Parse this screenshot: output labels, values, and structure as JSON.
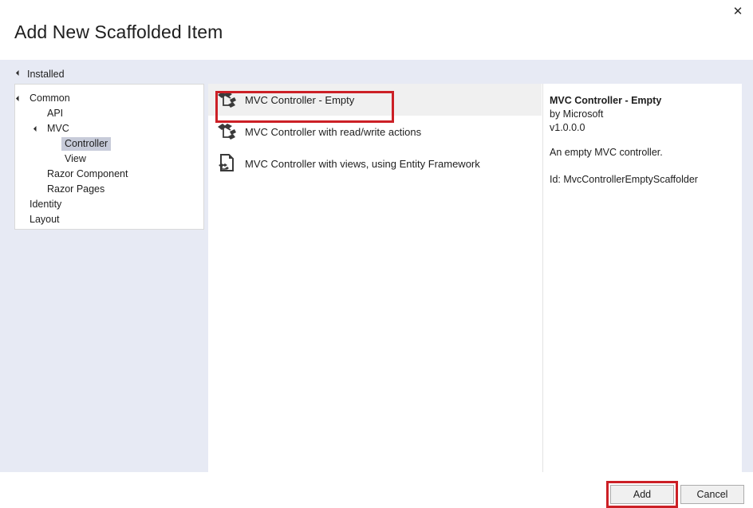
{
  "dialog": {
    "title": "Add New Scaffolded Item",
    "close_label": "✕",
    "close_icon": "close-icon"
  },
  "sidebar": {
    "group_label": "Installed",
    "group_icon": "chevron-expanded-icon",
    "tree": [
      {
        "label": "Common",
        "depth": 0,
        "expander": "chevron-expanded-icon",
        "selected": false
      },
      {
        "label": "API",
        "depth": 1,
        "expander": "",
        "selected": false
      },
      {
        "label": "MVC",
        "depth": 1,
        "expander": "chevron-expanded-icon",
        "selected": false
      },
      {
        "label": "Controller",
        "depth": 2,
        "expander": "",
        "selected": true
      },
      {
        "label": "View",
        "depth": 2,
        "expander": "",
        "selected": false
      },
      {
        "label": "Razor Component",
        "depth": 1,
        "expander": "",
        "selected": false
      },
      {
        "label": "Razor Pages",
        "depth": 1,
        "expander": "",
        "selected": false
      },
      {
        "label": "Identity",
        "depth": 0,
        "expander": "",
        "selected": false
      },
      {
        "label": "Layout",
        "depth": 0,
        "expander": "",
        "selected": false
      }
    ]
  },
  "list": {
    "items": [
      {
        "label": "MVC Controller - Empty",
        "icon": "controller-node-icon",
        "selected": true
      },
      {
        "label": "MVC Controller with read/write actions",
        "icon": "controller-node-icon",
        "selected": false
      },
      {
        "label": "MVC Controller with views, using Entity Framework",
        "icon": "document-node-icon",
        "selected": false
      }
    ]
  },
  "details": {
    "title": "MVC Controller - Empty",
    "author": "by Microsoft",
    "version": "v1.0.0.0",
    "description": "An empty MVC controller.",
    "id": "Id: MvcControllerEmptyScaffolder"
  },
  "footer": {
    "add_label": "Add",
    "cancel_label": "Cancel"
  },
  "colors": {
    "band": "#e7eaf4",
    "selection": "#f0f0f0",
    "tree_selection": "#c7cbd9",
    "annotation": "#cc2026",
    "text": "#1e1e1e"
  }
}
